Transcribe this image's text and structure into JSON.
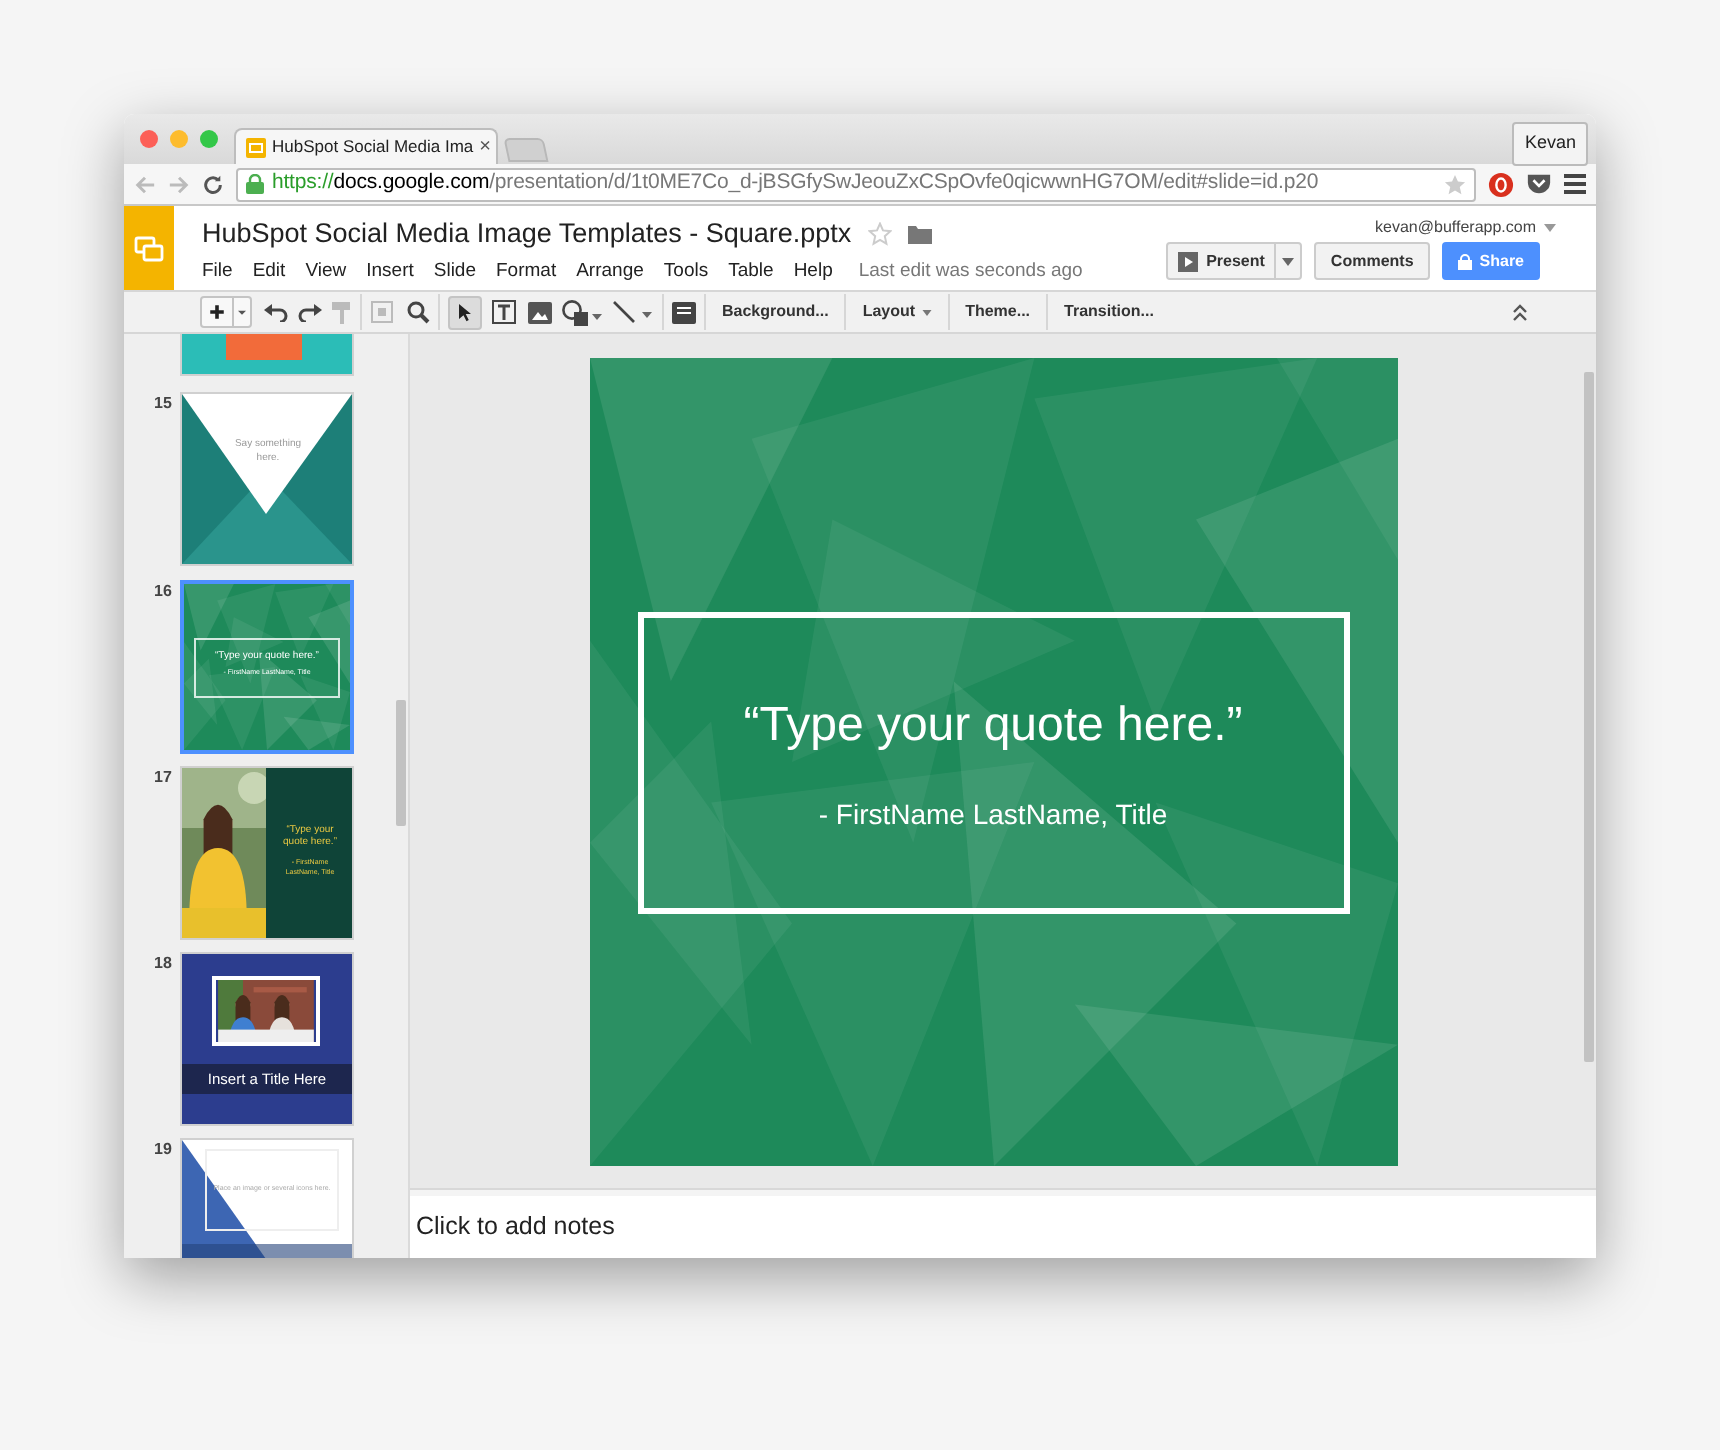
{
  "browser": {
    "tab_title": "HubSpot Social Media Ima",
    "tab_close": "×",
    "profile": "Kevan",
    "url_scheme": "https://",
    "url_host": "docs.google.com",
    "url_path": "/presentation/d/1t0ME7Co_d-jBSGfySwJeouZxCSpOvfe0qicwwnHG7OM/edit#slide=id.p20"
  },
  "doc": {
    "title": "HubSpot Social Media Image Templates - Square.pptx",
    "starred": false,
    "account": "kevan@bufferapp.com",
    "menu": [
      "File",
      "Edit",
      "View",
      "Insert",
      "Slide",
      "Format",
      "Arrange",
      "Tools",
      "Table",
      "Help"
    ],
    "last_edit": "Last edit was seconds ago",
    "present": "Present",
    "comments": "Comments",
    "share": "Share"
  },
  "toolbar": {
    "buttons": [
      {
        "label": "Background...",
        "dropdown": false
      },
      {
        "label": "Layout",
        "dropdown": true
      },
      {
        "label": "Theme...",
        "dropdown": false
      },
      {
        "label": "Transition...",
        "dropdown": false
      }
    ]
  },
  "filmstrip": [
    {
      "kind": "banner",
      "selected": false
    },
    {
      "number": "15",
      "kind": "triangle",
      "selected": false,
      "texts": [
        "Say something here."
      ]
    },
    {
      "number": "16",
      "kind": "quote",
      "selected": true,
      "texts": [
        "“Type your quote here.”",
        "- FirstName LastName, Title"
      ]
    },
    {
      "number": "17",
      "kind": "photo-quote",
      "selected": false,
      "texts": [
        "“Type your quote here.”",
        "- FirstName LastName, Title"
      ]
    },
    {
      "number": "18",
      "kind": "photo-title",
      "selected": false,
      "texts": [
        "Insert a Title Here"
      ]
    },
    {
      "number": "19",
      "kind": "diagonal",
      "selected": false,
      "texts": [
        "Place an image or several icons here."
      ]
    }
  ],
  "slide": {
    "quote": "“Type your quote here.”",
    "attribution": "- FirstName LastName, Title"
  },
  "notes": {
    "placeholder": "Click to add notes"
  }
}
